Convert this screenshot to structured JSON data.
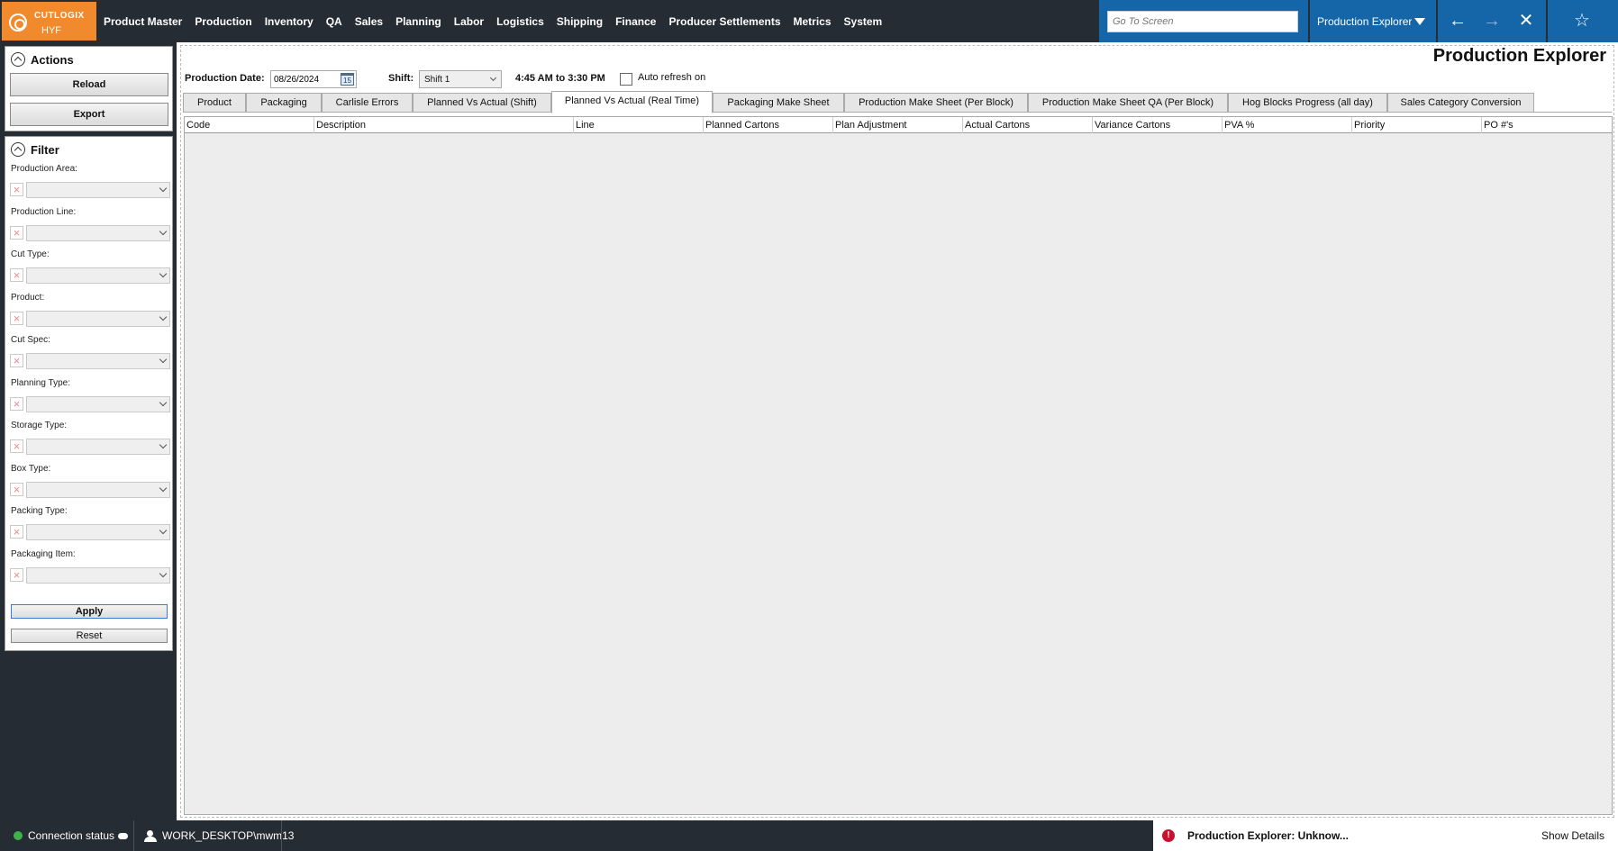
{
  "logo": {
    "brand": "CUTLOGIX",
    "sub": "HYF"
  },
  "nav": [
    "Product Master",
    "Production",
    "Inventory",
    "QA",
    "Sales",
    "Planning",
    "Labor",
    "Logistics",
    "Shipping",
    "Finance",
    "Producer Settlements",
    "Metrics",
    "System"
  ],
  "goto": {
    "placeholder": "Go To Screen"
  },
  "screen_select": {
    "value": "Production Explorer"
  },
  "actions": {
    "title": "Actions",
    "reload": "Reload",
    "export": "Export"
  },
  "filter": {
    "title": "Filter",
    "fields": [
      "Production Area:",
      "Production Line:",
      "Cut Type:",
      "Product:",
      "Cut Spec:",
      "Planning Type:",
      "Storage Type:",
      "Box Type:",
      "Packing Type:",
      "Packaging Item:"
    ],
    "apply": "Apply",
    "reset": "Reset"
  },
  "page_title": "Production Explorer",
  "toolbar": {
    "date_label": "Production Date:",
    "date_value": "08/26/2024",
    "calendar_day": "15",
    "shift_label": "Shift:",
    "shift_value": "Shift 1",
    "time_range": "4:45 AM to 3:30 PM",
    "auto_refresh": "Auto refresh on"
  },
  "tabs": [
    "Product",
    "Packaging",
    "Carlisle Errors",
    "Planned Vs Actual (Shift)",
    "Planned Vs Actual (Real Time)",
    "Packaging Make Sheet",
    "Production Make Sheet (Per Block)",
    "Production Make Sheet QA (Per Block)",
    "Hog Blocks Progress (all day)",
    "Sales Category Conversion"
  ],
  "active_tab": 4,
  "grid": {
    "columns": [
      "Code",
      "Description",
      "Line",
      "Planned Cartons",
      "Plan Adjustment",
      "Actual Cartons",
      "Variance Cartons",
      "PVA %",
      "Priority",
      "PO #'s"
    ]
  },
  "status": {
    "connection": "Connection status",
    "user": "WORK_DESKTOP\\mwm13",
    "notification": "Production Explorer: Unknow...",
    "details": "Show Details"
  },
  "colors": {
    "topbar": "#252c34",
    "accent": "#1565a9",
    "logo": "#f08a2d",
    "error": "#c8102e",
    "connected": "#3fb24a"
  }
}
